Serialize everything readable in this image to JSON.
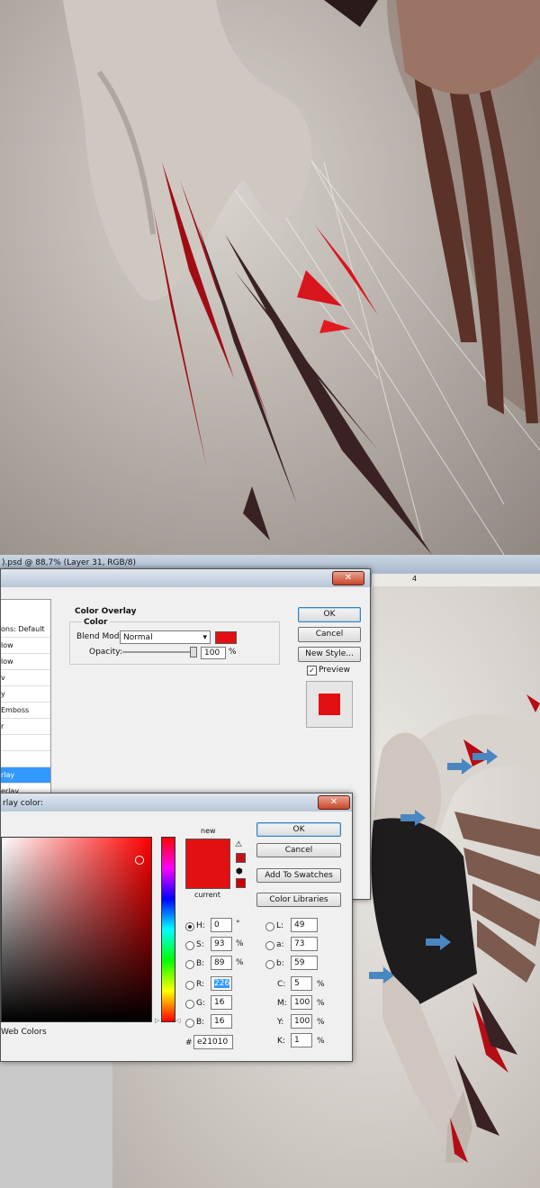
{
  "window": {
    "title": ").psd @ 88,7% (Layer 31, RGB/8)"
  },
  "ruler": {
    "mark": "4"
  },
  "layer_style": {
    "styles": [
      {
        "label": "ons: Default"
      },
      {
        "label": "low"
      },
      {
        "label": "low"
      },
      {
        "label": "v"
      },
      {
        "label": "y"
      },
      {
        "label": "Emboss"
      },
      {
        "label": "r"
      },
      {
        "label": ""
      },
      {
        "label": ""
      },
      {
        "label": "rlay"
      },
      {
        "label": "erlay"
      }
    ],
    "section_title": "Color Overlay",
    "group_title": "Color",
    "blend_mode_label": "Blend Mode:",
    "blend_mode_value": "Normal",
    "opacity_label": "Opacity:",
    "opacity_value": "100",
    "opacity_unit": "%",
    "overlay_color": "#e21010",
    "ok_label": "OK",
    "cancel_label": "Cancel",
    "new_style_label": "New Style...",
    "preview_label": "Preview",
    "preview_checked": true
  },
  "color_picker": {
    "title": "rlay color:",
    "new_label": "new",
    "current_label": "current",
    "new_color": "#e21010",
    "current_color": "#e21010",
    "ok_label": "OK",
    "cancel_label": "Cancel",
    "add_swatches_label": "Add To Swatches",
    "libraries_label": "Color Libraries",
    "web_colors_label": "Web Colors",
    "hsb": [
      {
        "key": "H:",
        "value": "0",
        "unit": "°",
        "selected": true
      },
      {
        "key": "S:",
        "value": "93",
        "unit": "%",
        "selected": false
      },
      {
        "key": "B:",
        "value": "89",
        "unit": "%",
        "selected": false
      }
    ],
    "rgb": [
      {
        "key": "R:",
        "value": "226",
        "selected": false
      },
      {
        "key": "G:",
        "value": "16",
        "selected": false
      },
      {
        "key": "B:",
        "value": "16",
        "selected": false
      }
    ],
    "lab": [
      {
        "key": "L:",
        "value": "49"
      },
      {
        "key": "a:",
        "value": "73"
      },
      {
        "key": "b:",
        "value": "59"
      }
    ],
    "cmyk": [
      {
        "key": "C:",
        "value": "5",
        "unit": "%"
      },
      {
        "key": "M:",
        "value": "100",
        "unit": "%"
      },
      {
        "key": "Y:",
        "value": "100",
        "unit": "%"
      },
      {
        "key": "K:",
        "value": "1",
        "unit": "%"
      }
    ],
    "hex_label": "#",
    "hex_value": "e21010"
  },
  "colors": {
    "accent": "#e21010",
    "arrow": "#4a86c0",
    "selection": "#3399ff"
  }
}
